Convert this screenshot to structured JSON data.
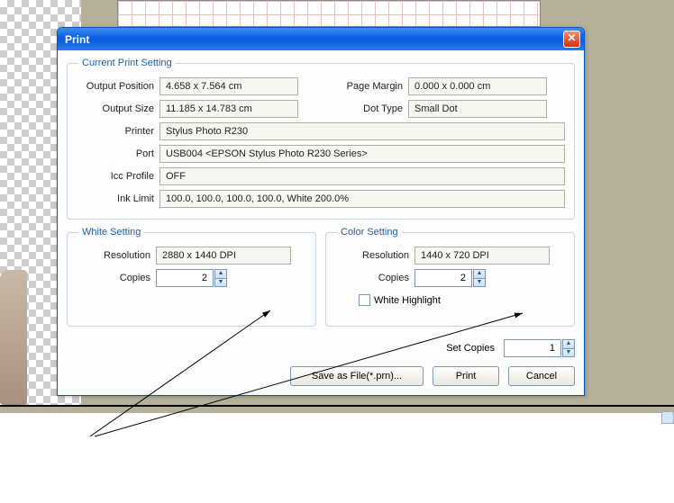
{
  "dialog": {
    "title": "Print",
    "groups": {
      "current": {
        "legend": "Current Print Setting",
        "output_position_label": "Output Position",
        "output_position": "4.658 x 7.564 cm",
        "page_margin_label": "Page Margin",
        "page_margin": "0.000 x 0.000 cm",
        "output_size_label": "Output Size",
        "output_size": "11.185 x 14.783 cm",
        "dot_type_label": "Dot Type",
        "dot_type": "Small Dot",
        "printer_label": "Printer",
        "printer": "Stylus Photo R230",
        "port_label": "Port",
        "port": "USB004  <EPSON Stylus Photo R230 Series>",
        "icc_label": "Icc Profile",
        "icc": "OFF",
        "ink_label": "Ink Limit",
        "ink": "100.0, 100.0, 100.0, 100.0, White 200.0%"
      },
      "white": {
        "legend": "White Setting",
        "resolution_label": "Resolution",
        "resolution": "2880 x 1440 DPI",
        "copies_label": "Copies",
        "copies": "2"
      },
      "color": {
        "legend": "Color Setting",
        "resolution_label": "Resolution",
        "resolution": "1440 x 720 DPI",
        "copies_label": "Copies",
        "copies": "2",
        "white_highlight_label": "White Highlight"
      }
    },
    "set_copies_label": "Set Copies",
    "set_copies": "1",
    "buttons": {
      "save": "Save as File(*.prn)...",
      "print": "Print",
      "cancel": "Cancel"
    }
  }
}
